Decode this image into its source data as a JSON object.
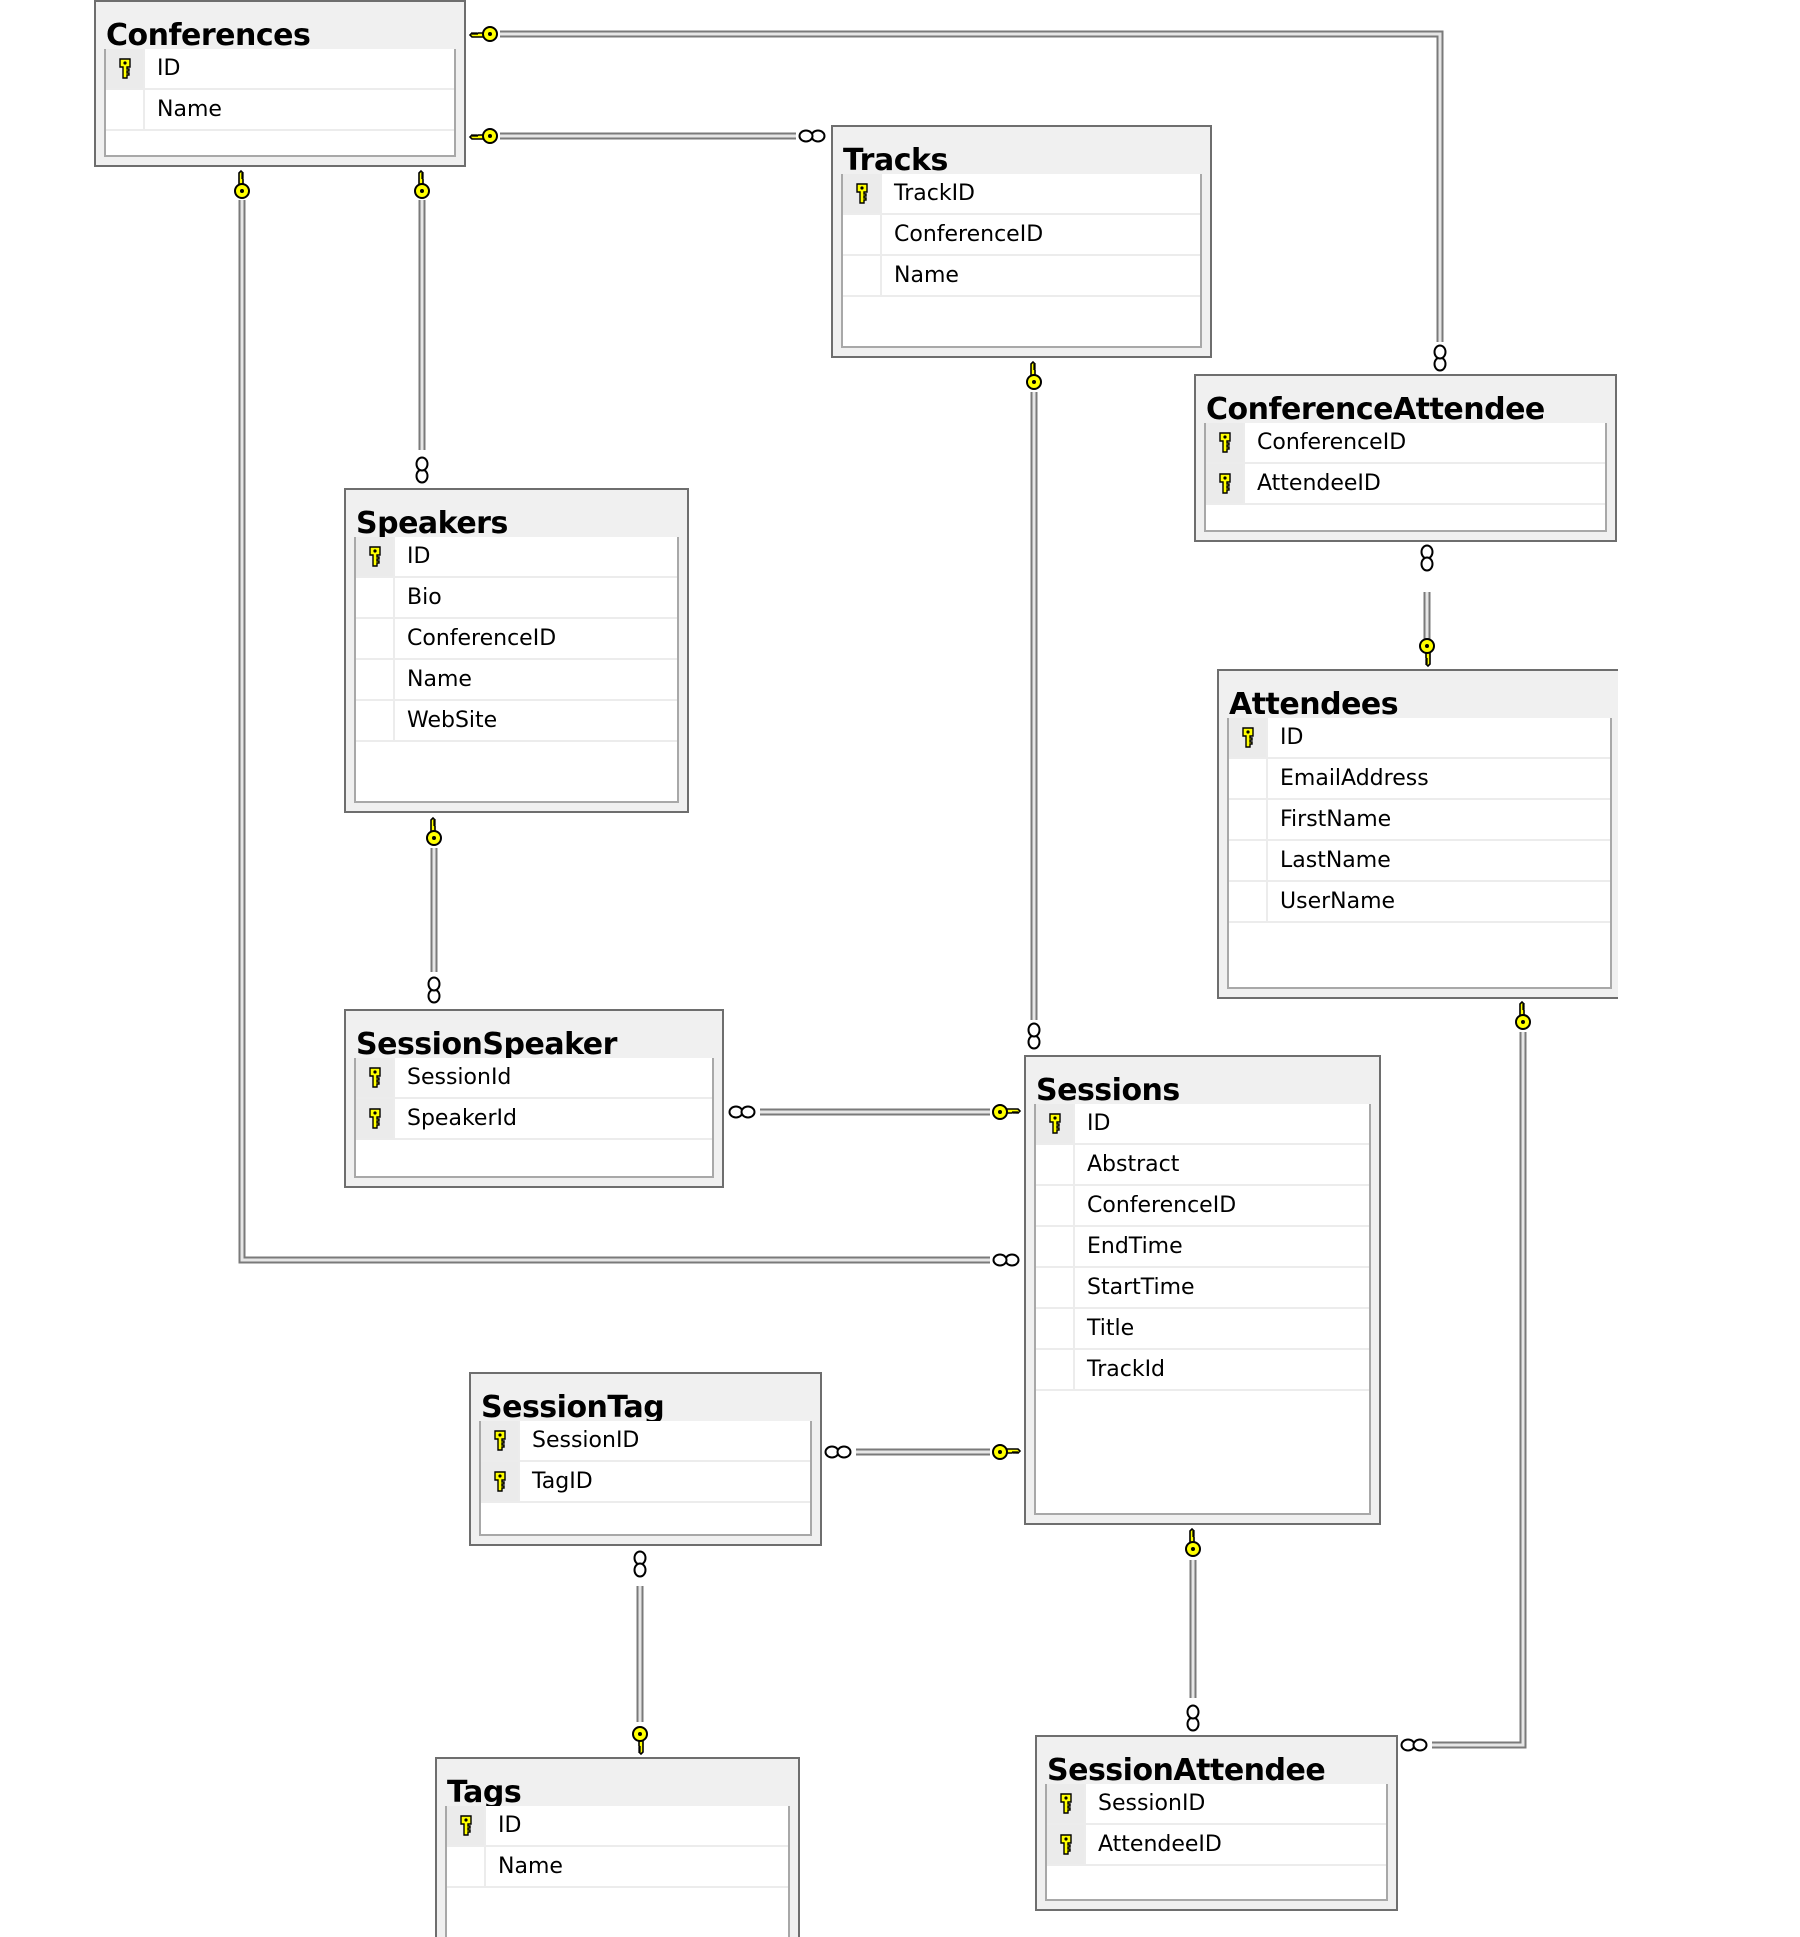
{
  "diagram": {
    "type": "database-relationship-diagram",
    "tables": [
      {
        "id": "conferences",
        "name": "Conferences",
        "columns": [
          {
            "name": "ID",
            "pk": true
          },
          {
            "name": "Name",
            "pk": false
          }
        ]
      },
      {
        "id": "tracks",
        "name": "Tracks",
        "columns": [
          {
            "name": "TrackID",
            "pk": true
          },
          {
            "name": "ConferenceID",
            "pk": false
          },
          {
            "name": "Name",
            "pk": false
          }
        ]
      },
      {
        "id": "conferenceattendee",
        "name": "ConferenceAttendee",
        "columns": [
          {
            "name": "ConferenceID",
            "pk": true
          },
          {
            "name": "AttendeeID",
            "pk": true
          }
        ]
      },
      {
        "id": "speakers",
        "name": "Speakers",
        "columns": [
          {
            "name": "ID",
            "pk": true
          },
          {
            "name": "Bio",
            "pk": false
          },
          {
            "name": "ConferenceID",
            "pk": false
          },
          {
            "name": "Name",
            "pk": false
          },
          {
            "name": "WebSite",
            "pk": false
          }
        ]
      },
      {
        "id": "attendees",
        "name": "Attendees",
        "columns": [
          {
            "name": "ID",
            "pk": true
          },
          {
            "name": "EmailAddress",
            "pk": false
          },
          {
            "name": "FirstName",
            "pk": false
          },
          {
            "name": "LastName",
            "pk": false
          },
          {
            "name": "UserName",
            "pk": false
          }
        ]
      },
      {
        "id": "sessionspeaker",
        "name": "SessionSpeaker",
        "columns": [
          {
            "name": "SessionId",
            "pk": true
          },
          {
            "name": "SpeakerId",
            "pk": true
          }
        ]
      },
      {
        "id": "sessions",
        "name": "Sessions",
        "columns": [
          {
            "name": "ID",
            "pk": true
          },
          {
            "name": "Abstract",
            "pk": false
          },
          {
            "name": "ConferenceID",
            "pk": false
          },
          {
            "name": "EndTime",
            "pk": false
          },
          {
            "name": "StartTime",
            "pk": false
          },
          {
            "name": "Title",
            "pk": false
          },
          {
            "name": "TrackId",
            "pk": false
          }
        ]
      },
      {
        "id": "sessiontag",
        "name": "SessionTag",
        "columns": [
          {
            "name": "SessionID",
            "pk": true
          },
          {
            "name": "TagID",
            "pk": true
          }
        ]
      },
      {
        "id": "tags",
        "name": "Tags",
        "columns": [
          {
            "name": "ID",
            "pk": true
          },
          {
            "name": "Name",
            "pk": false
          }
        ]
      },
      {
        "id": "sessionattendee",
        "name": "SessionAttendee",
        "columns": [
          {
            "name": "SessionID",
            "pk": true
          },
          {
            "name": "AttendeeID",
            "pk": true
          }
        ]
      }
    ],
    "relationships": [
      {
        "one": "conferences",
        "many": "conferenceattendee"
      },
      {
        "one": "conferences",
        "many": "tracks"
      },
      {
        "one": "conferences",
        "many": "speakers"
      },
      {
        "one": "conferences",
        "many": "sessions"
      },
      {
        "one": "tracks",
        "many": "sessions"
      },
      {
        "one": "attendees",
        "many": "conferenceattendee"
      },
      {
        "one": "speakers",
        "many": "sessionspeaker"
      },
      {
        "one": "sessions",
        "many": "sessionspeaker"
      },
      {
        "one": "sessions",
        "many": "sessiontag"
      },
      {
        "one": "tags",
        "many": "sessiontag"
      },
      {
        "one": "sessions",
        "many": "sessionattendee"
      },
      {
        "one": "attendees",
        "many": "sessionattendee"
      }
    ],
    "colors": {
      "key_fill": "#ffff00",
      "line": "#a0a0a0",
      "header_bg": "#f0f0f0",
      "border": "#6e6e6e"
    }
  }
}
